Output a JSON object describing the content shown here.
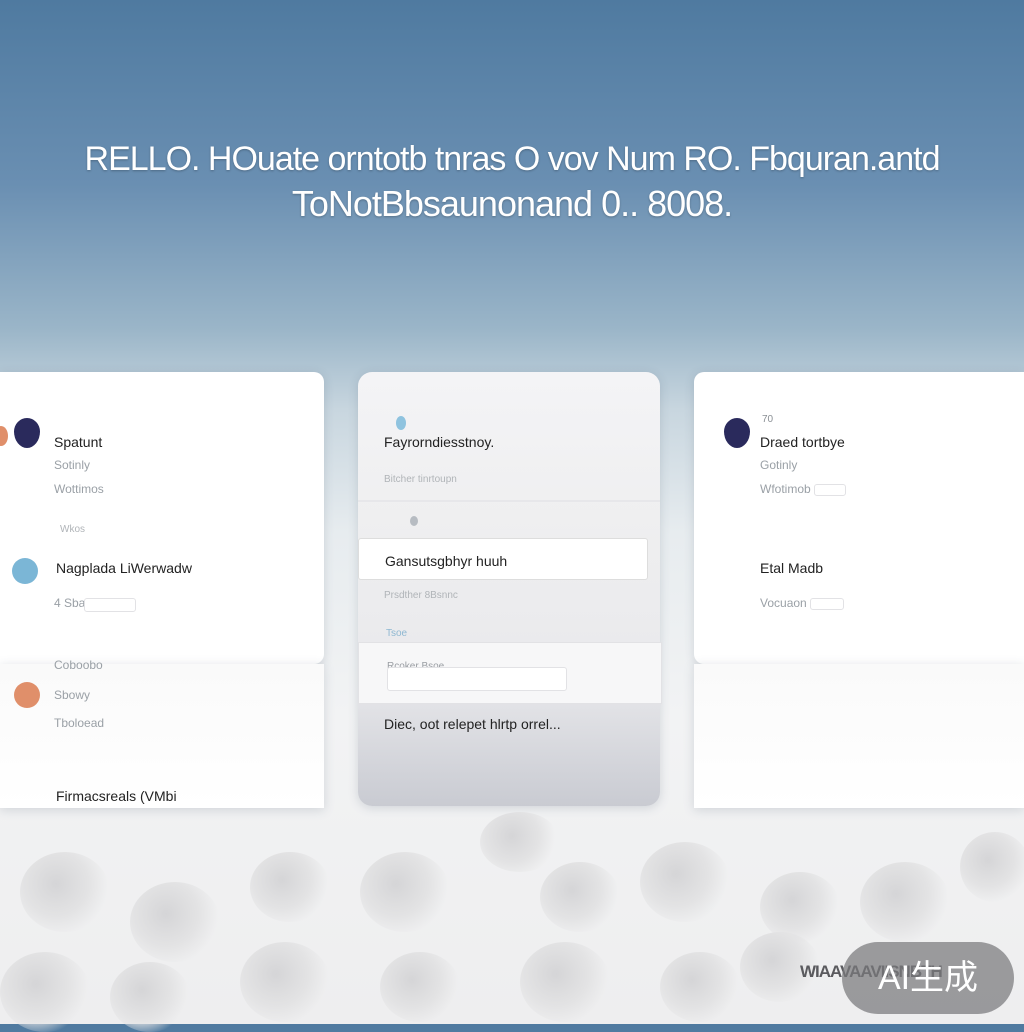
{
  "hero": {
    "line1": "RELLO. HOuate orntotb tnras O vov Num RO. Fbquran.antd",
    "line2": "ToNotBbsaunonand 0.. 8008."
  },
  "left_card": {
    "title": "Spatunt",
    "sub1": "Sotinly",
    "sub2": "Wottimos",
    "tiny": "Wkos",
    "item_title": "Nagplada LiWerwadw",
    "item_sub": "4 Sbaillo",
    "lower1": "Coboobo",
    "lower2": "Sbowy",
    "lower3": "Tboloead",
    "footer": "Firmacsreals (VMbi"
  },
  "center_card": {
    "title": "Fayrorndiesstnoy.",
    "sub": "Bitcher tinrtoupn",
    "field1_value": "Gansutsgbhyr huuh",
    "field1_label": "Prsdther 8Bsnnc",
    "section": "Tsoe",
    "field2_value": "Rcoker Bsoe",
    "footer": "Diec, oot relepet hlrtp orrel..."
  },
  "right_card": {
    "pin_number": "70",
    "title": "Draed tortbye",
    "sub1": "Gotinly",
    "sub2": "Wfotimob",
    "item_title": "Etal Madb",
    "item_sub": "Vocuaon"
  },
  "watermark": {
    "badge": "AI生成",
    "text": "WIAAVAAVIISNBTH"
  },
  "colors": {
    "pin": "#2a2a5c",
    "orange_dot": "#e08f6a",
    "blue_dot": "#7bb6d6"
  }
}
